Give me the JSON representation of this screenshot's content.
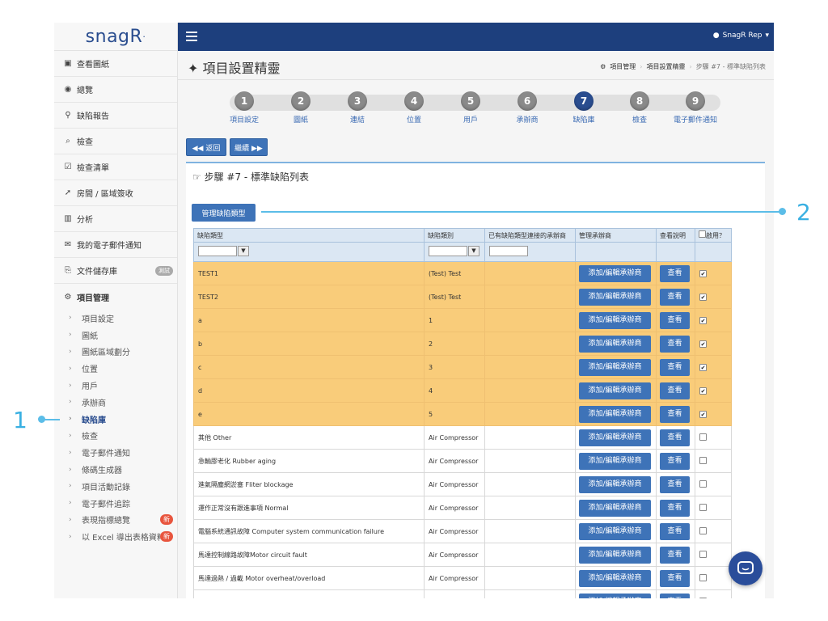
{
  "app": {
    "logo": "snagR",
    "logo_mark": "·"
  },
  "topbar": {
    "user": "SnagR Rep"
  },
  "sidebar": {
    "items": [
      {
        "icon": "▣",
        "label": "查看圖紙"
      },
      {
        "icon": "◉",
        "label": "總覽"
      },
      {
        "icon": "⚲",
        "label": "缺陷報告"
      },
      {
        "icon": "⌕",
        "label": "檢查"
      },
      {
        "icon": "☑",
        "label": "檢查清單"
      },
      {
        "icon": "➚",
        "label": "房間 / 區域簽收"
      },
      {
        "icon": "▥",
        "label": "分析"
      },
      {
        "icon": "✉",
        "label": "我的電子郵件通知"
      },
      {
        "icon": "⎘",
        "label": "文件儲存庫",
        "badge": "測試"
      }
    ],
    "section": {
      "icon": "⚙",
      "label": "項目管理"
    },
    "sub_items": [
      {
        "label": "項目設定"
      },
      {
        "label": "圖紙"
      },
      {
        "label": "圖紙區域劃分"
      },
      {
        "label": "位置"
      },
      {
        "label": "用戶"
      },
      {
        "label": "承辦商"
      },
      {
        "label": "缺陷庫",
        "active": true
      },
      {
        "label": "檢查"
      },
      {
        "label": "電子郵件通知"
      },
      {
        "label": "條碼生成器"
      },
      {
        "label": "項目活動記錄"
      },
      {
        "label": "電子郵件追踪"
      },
      {
        "label": "表現指標總覽",
        "badge": "新"
      },
      {
        "label": "以 Excel 導出表格資料",
        "badge": "新"
      }
    ]
  },
  "header": {
    "title": "項目設置精靈",
    "breadcrumb": [
      "項目管理",
      "項目設置精靈",
      "步驟 #7 - 標準缺陷列表"
    ]
  },
  "stepper": {
    "active": 7,
    "steps": [
      {
        "num": "1",
        "label": "項目設定"
      },
      {
        "num": "2",
        "label": "圖紙"
      },
      {
        "num": "3",
        "label": "連結"
      },
      {
        "num": "4",
        "label": "位置"
      },
      {
        "num": "5",
        "label": "用戶"
      },
      {
        "num": "6",
        "label": "承辦商"
      },
      {
        "num": "7",
        "label": "缺陷庫"
      },
      {
        "num": "8",
        "label": "檢查"
      },
      {
        "num": "9",
        "label": "電子郵件通知"
      }
    ]
  },
  "buttons": {
    "back": "◀◀ 返回",
    "next": "繼續 ▶▶",
    "manage": "管理缺陷類型"
  },
  "panel": {
    "title": "步驟 #7 - 標準缺陷列表"
  },
  "table": {
    "headers": [
      "缺陷類型",
      "缺陷類別",
      "已有缺陷類型連接的承辦商",
      "管理承辦商",
      "查看說明",
      "啟用？"
    ],
    "action_label": "添加/編輯承辦商",
    "view_label": "查看",
    "rows": [
      {
        "type": "TEST1",
        "category": "(Test) Test",
        "enabled": true,
        "highlight": true
      },
      {
        "type": "TEST2",
        "category": "(Test) Test",
        "enabled": true,
        "highlight": true
      },
      {
        "type": "a",
        "category": "1",
        "enabled": true,
        "highlight": true
      },
      {
        "type": "b",
        "category": "2",
        "enabled": true,
        "highlight": true
      },
      {
        "type": "c",
        "category": "3",
        "enabled": true,
        "highlight": true
      },
      {
        "type": "d",
        "category": "4",
        "enabled": true,
        "highlight": true
      },
      {
        "type": "e",
        "category": "5",
        "enabled": true,
        "highlight": true
      },
      {
        "type": "其他 Other",
        "category": "Air Compressor",
        "enabled": false,
        "highlight": false
      },
      {
        "type": "急輸膠老化 Rubber aging",
        "category": "Air Compressor",
        "enabled": false,
        "highlight": false
      },
      {
        "type": "進氣隔塵網淤塞 Fliter blockage",
        "category": "Air Compressor",
        "enabled": false,
        "highlight": false
      },
      {
        "type": "運作正常沒有跟進事項 Normal",
        "category": "Air Compressor",
        "enabled": false,
        "highlight": false
      },
      {
        "type": "電腦系統通訊故障 Computer system communication failure",
        "category": "Air Compressor",
        "enabled": false,
        "highlight": false
      },
      {
        "type": "馬達控制線路故障Motor circuit fault",
        "category": "Air Compressor",
        "enabled": false,
        "highlight": false
      },
      {
        "type": "馬達過熱 / 過載 Motor overheat/overload",
        "category": "Air Compressor",
        "enabled": false,
        "highlight": false
      },
      {
        "type": "",
        "category": "",
        "enabled": false,
        "highlight": false
      }
    ]
  },
  "callouts": {
    "one": "1",
    "two": "2"
  },
  "colors": {
    "topbar": "#1d3f7d",
    "button": "#3e73b8",
    "highlight_row": "#f9cc7a",
    "callout": "#3ab0e2"
  }
}
